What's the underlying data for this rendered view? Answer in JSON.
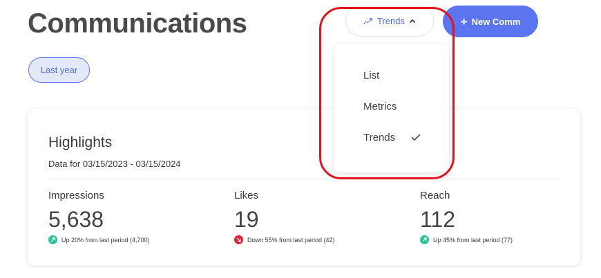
{
  "header": {
    "title": "Communications",
    "view_toggle_label": "Trends",
    "new_button_label": "New Comm"
  },
  "filter": {
    "label": "Last year"
  },
  "highlights": {
    "title": "Highlights",
    "subtitle": "Data for 03/15/2023 - 03/15/2024",
    "metrics": [
      {
        "label": "Impressions",
        "value": "5,638",
        "change": "Up 20% from last period (4,700)",
        "trend": "up"
      },
      {
        "label": "Likes",
        "value": "19",
        "change": "Down 55% from last period (42)",
        "trend": "down"
      },
      {
        "label": "Reach",
        "value": "112",
        "change": "Up 45% from last period (77)",
        "trend": "up"
      }
    ]
  },
  "view_menu": {
    "items": [
      {
        "label": "List",
        "selected": false
      },
      {
        "label": "Metrics",
        "selected": false
      },
      {
        "label": "Trends",
        "selected": true
      }
    ]
  },
  "colors": {
    "accent": "#5b74f0",
    "up": "#2fc197",
    "down": "#e3223c",
    "annotation": "#e3101e"
  },
  "icons": {
    "view_toggle": "trend-line-icon",
    "caret": "chevron-up-icon",
    "new": "plus-icon",
    "selected": "checkmark-icon"
  }
}
